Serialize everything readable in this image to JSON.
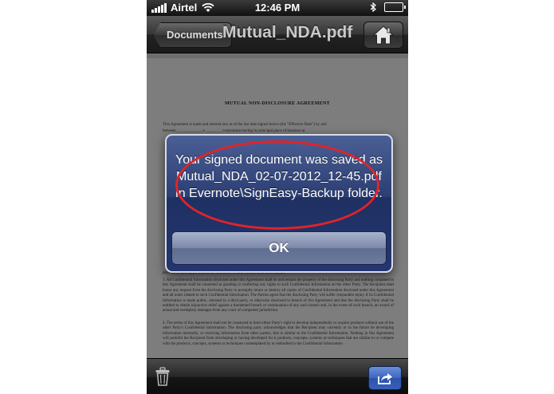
{
  "status_bar": {
    "carrier": "Airtel",
    "time": "12:46 PM"
  },
  "nav": {
    "back_label": "Documents",
    "title": "Mutual_NDA.pdf"
  },
  "document": {
    "heading": "MUTUAL NON-DISCLOSURE AGREEMENT",
    "intro_line_1": "This Agreement is made and entered into as of the last date signed below (the \"Effective Date\") by and",
    "intro_line_2": "between ____________, a ________ corporation having its principal place of business at",
    "clause_2_tail": "physical acquiring production or disclosure of said Confidential Information.",
    "clause_3": "3.        All Confidential Information disclosed under this Agreement shall be and remain the property of the disclosing Party and nothing contained in this Agreement shall be construed as granting or conferring any rights to such Confidential Information on the other Party. The Recipient shall honor any request from the disclosing Party to promptly return or destroy all copies of Confidential Information disclosed under this Agreement and all notes related to such Confidential Information. The Parties agree that the disclosing Party will suffer irreparable injury if its Confidential Information is made public, released to a third party, or otherwise disclosed in breach of this Agreement and that the disclosing Party shall be entitled to obtain injunctive relief against a threatened breach or continuation of any such breach and, in the event of such breach, an award of actual and exemplary damages from any court of competent jurisdiction.",
    "clause_4": "4.        The terms of this Agreement shall not be construed to limit either Party's right to develop independently or acquire products without use of the other Party's Confidential Information. The disclosing party acknowledges that the Recipient may currently or in the future be developing information internally, or receiving information from other parties, that is similar to the Confidential Information. Nothing in this Agreement will prohibit the Recipient from developing or having developed for it products, concepts, systems or techniques that are similar to or compete with the products, concepts, systems or techniques contemplated by or embodied in the Confidential Information"
  },
  "alert": {
    "message": "Your signed document was saved as Mutual_NDA_02-07-2012_12-45.pdf in Evernote\\SignEasy-Backup folder.",
    "ok_label": "OK",
    "highlight_color": "#e0242a"
  },
  "icons": {
    "wifi": "wifi-icon",
    "bluetooth": "bluetooth-icon",
    "battery": "battery-icon",
    "home": "home-icon",
    "trash": "trash-icon",
    "share": "share-icon"
  }
}
